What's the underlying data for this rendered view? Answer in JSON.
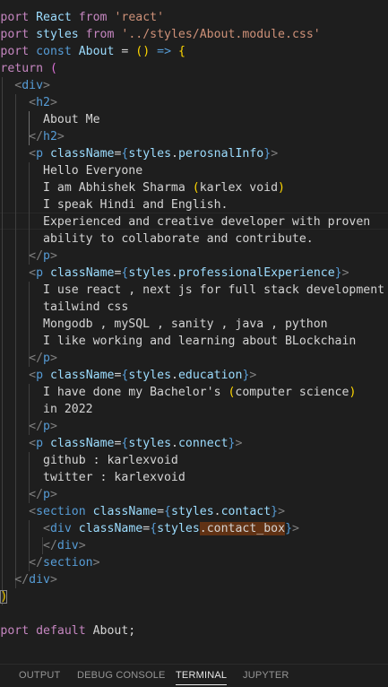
{
  "editor": {
    "lines": [
      [
        [
          "import",
          "kw"
        ],
        [
          " React ",
          "id"
        ],
        [
          "from",
          "kw"
        ],
        [
          " ",
          "txt"
        ],
        [
          "'react'",
          "str"
        ]
      ],
      [
        [
          "import",
          "kw"
        ],
        [
          " styles ",
          "id"
        ],
        [
          "from",
          "kw"
        ],
        [
          " ",
          "txt"
        ],
        [
          "'../styles/About.module.css'",
          "str"
        ]
      ],
      [
        [
          "export",
          "kw"
        ],
        [
          " ",
          "txt"
        ],
        [
          "const",
          "var"
        ],
        [
          " About ",
          "id"
        ],
        [
          "=",
          "txt"
        ],
        [
          " ",
          "txt"
        ],
        [
          "()",
          "par1"
        ],
        [
          " ",
          "txt"
        ],
        [
          "=>",
          "var"
        ],
        [
          " ",
          "txt"
        ],
        [
          "{",
          "par1"
        ]
      ],
      [
        [
          "  ",
          "txt"
        ],
        [
          "return",
          "kw"
        ],
        [
          " ",
          "txt"
        ],
        [
          "(",
          "par2"
        ]
      ],
      [
        [
          "    ",
          "txt"
        ],
        [
          "<",
          "punc"
        ],
        [
          "div",
          "tag"
        ],
        [
          ">",
          "punc"
        ]
      ],
      [
        [
          "      ",
          "txt"
        ],
        [
          "<",
          "punc"
        ],
        [
          "h2",
          "tag"
        ],
        [
          ">",
          "punc"
        ]
      ],
      [
        [
          "        About Me",
          "txt"
        ]
      ],
      [
        [
          "      ",
          "txt"
        ],
        [
          "</",
          "punc"
        ],
        [
          "h2",
          "tag"
        ],
        [
          ">",
          "punc"
        ]
      ],
      [
        [
          "      ",
          "txt"
        ],
        [
          "<",
          "punc"
        ],
        [
          "p",
          "tag"
        ],
        [
          " ",
          "txt"
        ],
        [
          "className",
          "attr"
        ],
        [
          "=",
          "txt"
        ],
        [
          "{",
          "brace"
        ],
        [
          "styles",
          "id"
        ],
        [
          ".",
          "txt"
        ],
        [
          "perosnalInfo",
          "id"
        ],
        [
          "}",
          "brace"
        ],
        [
          ">",
          "punc"
        ]
      ],
      [
        [
          "        Hello Everyone",
          "txt"
        ]
      ],
      [
        [
          "        I am Abhishek Sharma ",
          "txt"
        ],
        [
          "(",
          "par1"
        ],
        [
          "karlex void",
          "txt"
        ],
        [
          ")",
          "par1"
        ]
      ],
      [
        [
          "        I speak Hindi and English.",
          "txt"
        ]
      ],
      [
        [
          "        Experienced and creative developer with proven",
          "txt"
        ]
      ],
      [
        [
          "        ability to collaborate and contribute.",
          "txt"
        ]
      ],
      [
        [
          "      ",
          "txt"
        ],
        [
          "</",
          "punc"
        ],
        [
          "p",
          "tag"
        ],
        [
          ">",
          "punc"
        ]
      ],
      [
        [
          "      ",
          "txt"
        ],
        [
          "<",
          "punc"
        ],
        [
          "p",
          "tag"
        ],
        [
          " ",
          "txt"
        ],
        [
          "className",
          "attr"
        ],
        [
          "=",
          "txt"
        ],
        [
          "{",
          "brace"
        ],
        [
          "styles",
          "id"
        ],
        [
          ".",
          "txt"
        ],
        [
          "professionalExperience",
          "id"
        ],
        [
          "}",
          "brace"
        ],
        [
          ">",
          "punc"
        ]
      ],
      [
        [
          "        I use react , next js for full stack development",
          "txt"
        ]
      ],
      [
        [
          "        tailwind css",
          "txt"
        ]
      ],
      [
        [
          "        Mongodb , mySQL , sanity , java , python",
          "txt"
        ]
      ],
      [
        [
          "        I like working and learning about BLockchain",
          "txt"
        ]
      ],
      [
        [
          "      ",
          "txt"
        ],
        [
          "</",
          "punc"
        ],
        [
          "p",
          "tag"
        ],
        [
          ">",
          "punc"
        ]
      ],
      [
        [
          "      ",
          "txt"
        ],
        [
          "<",
          "punc"
        ],
        [
          "p",
          "tag"
        ],
        [
          " ",
          "txt"
        ],
        [
          "className",
          "attr"
        ],
        [
          "=",
          "txt"
        ],
        [
          "{",
          "brace"
        ],
        [
          "styles",
          "id"
        ],
        [
          ".",
          "txt"
        ],
        [
          "education",
          "id"
        ],
        [
          "}",
          "brace"
        ],
        [
          ">",
          "punc"
        ]
      ],
      [
        [
          "        I have done my Bachelor's ",
          "txt"
        ],
        [
          "(",
          "par1"
        ],
        [
          "computer science",
          "txt"
        ],
        [
          ")",
          "par1"
        ]
      ],
      [
        [
          "        in 2022",
          "txt"
        ]
      ],
      [
        [
          "      ",
          "txt"
        ],
        [
          "</",
          "punc"
        ],
        [
          "p",
          "tag"
        ],
        [
          ">",
          "punc"
        ]
      ],
      [
        [
          "      ",
          "txt"
        ],
        [
          "<",
          "punc"
        ],
        [
          "p",
          "tag"
        ],
        [
          " ",
          "txt"
        ],
        [
          "className",
          "attr"
        ],
        [
          "=",
          "txt"
        ],
        [
          "{",
          "brace"
        ],
        [
          "styles",
          "id"
        ],
        [
          ".",
          "txt"
        ],
        [
          "connect",
          "id"
        ],
        [
          "}",
          "brace"
        ],
        [
          ">",
          "punc"
        ]
      ],
      [
        [
          "        github : karlexvoid",
          "txt"
        ]
      ],
      [
        [
          "        twitter : karlexvoid",
          "txt"
        ]
      ],
      [
        [
          "      ",
          "txt"
        ],
        [
          "</",
          "punc"
        ],
        [
          "p",
          "tag"
        ],
        [
          ">",
          "punc"
        ]
      ],
      [
        [
          "      ",
          "txt"
        ],
        [
          "<",
          "punc"
        ],
        [
          "section",
          "tag"
        ],
        [
          " ",
          "txt"
        ],
        [
          "className",
          "attr"
        ],
        [
          "=",
          "txt"
        ],
        [
          "{",
          "brace"
        ],
        [
          "styles",
          "id"
        ],
        [
          ".",
          "txt"
        ],
        [
          "contact",
          "id"
        ],
        [
          "}",
          "brace"
        ],
        [
          ">",
          "punc"
        ]
      ],
      [
        [
          "        ",
          "txt"
        ],
        [
          "<",
          "punc"
        ],
        [
          "div",
          "tag"
        ],
        [
          " ",
          "txt"
        ],
        [
          "className",
          "attr"
        ],
        [
          "=",
          "txt"
        ],
        [
          "{",
          "brace"
        ],
        [
          "styles",
          "id"
        ],
        [
          ".contact_box",
          "hl"
        ],
        [
          "}",
          "brace"
        ],
        [
          ">",
          "punc"
        ]
      ],
      [
        [
          "        ",
          "txt"
        ],
        [
          "</",
          "punc"
        ],
        [
          "div",
          "tag"
        ],
        [
          ">",
          "punc"
        ]
      ],
      [
        [
          "      ",
          "txt"
        ],
        [
          "</",
          "punc"
        ],
        [
          "section",
          "tag"
        ],
        [
          ">",
          "punc"
        ]
      ],
      [
        [
          "    ",
          "txt"
        ],
        [
          "</",
          "punc"
        ],
        [
          "div",
          "tag"
        ],
        [
          ">",
          "punc"
        ]
      ],
      [
        [
          "  ",
          "txt"
        ],
        [
          ")",
          "bm"
        ]
      ],
      [
        [
          "",
          "txt"
        ]
      ],
      [
        [
          "export",
          "kw"
        ],
        [
          " ",
          "txt"
        ],
        [
          "default",
          "kw"
        ],
        [
          " About;",
          "txt"
        ]
      ]
    ]
  },
  "panel": {
    "tabs": [
      {
        "label": "OUTPUT",
        "active": false
      },
      {
        "label": "DEBUG CONSOLE",
        "active": false
      },
      {
        "label": "TERMINAL",
        "active": true
      },
      {
        "label": "JUPYTER",
        "active": false
      }
    ]
  }
}
